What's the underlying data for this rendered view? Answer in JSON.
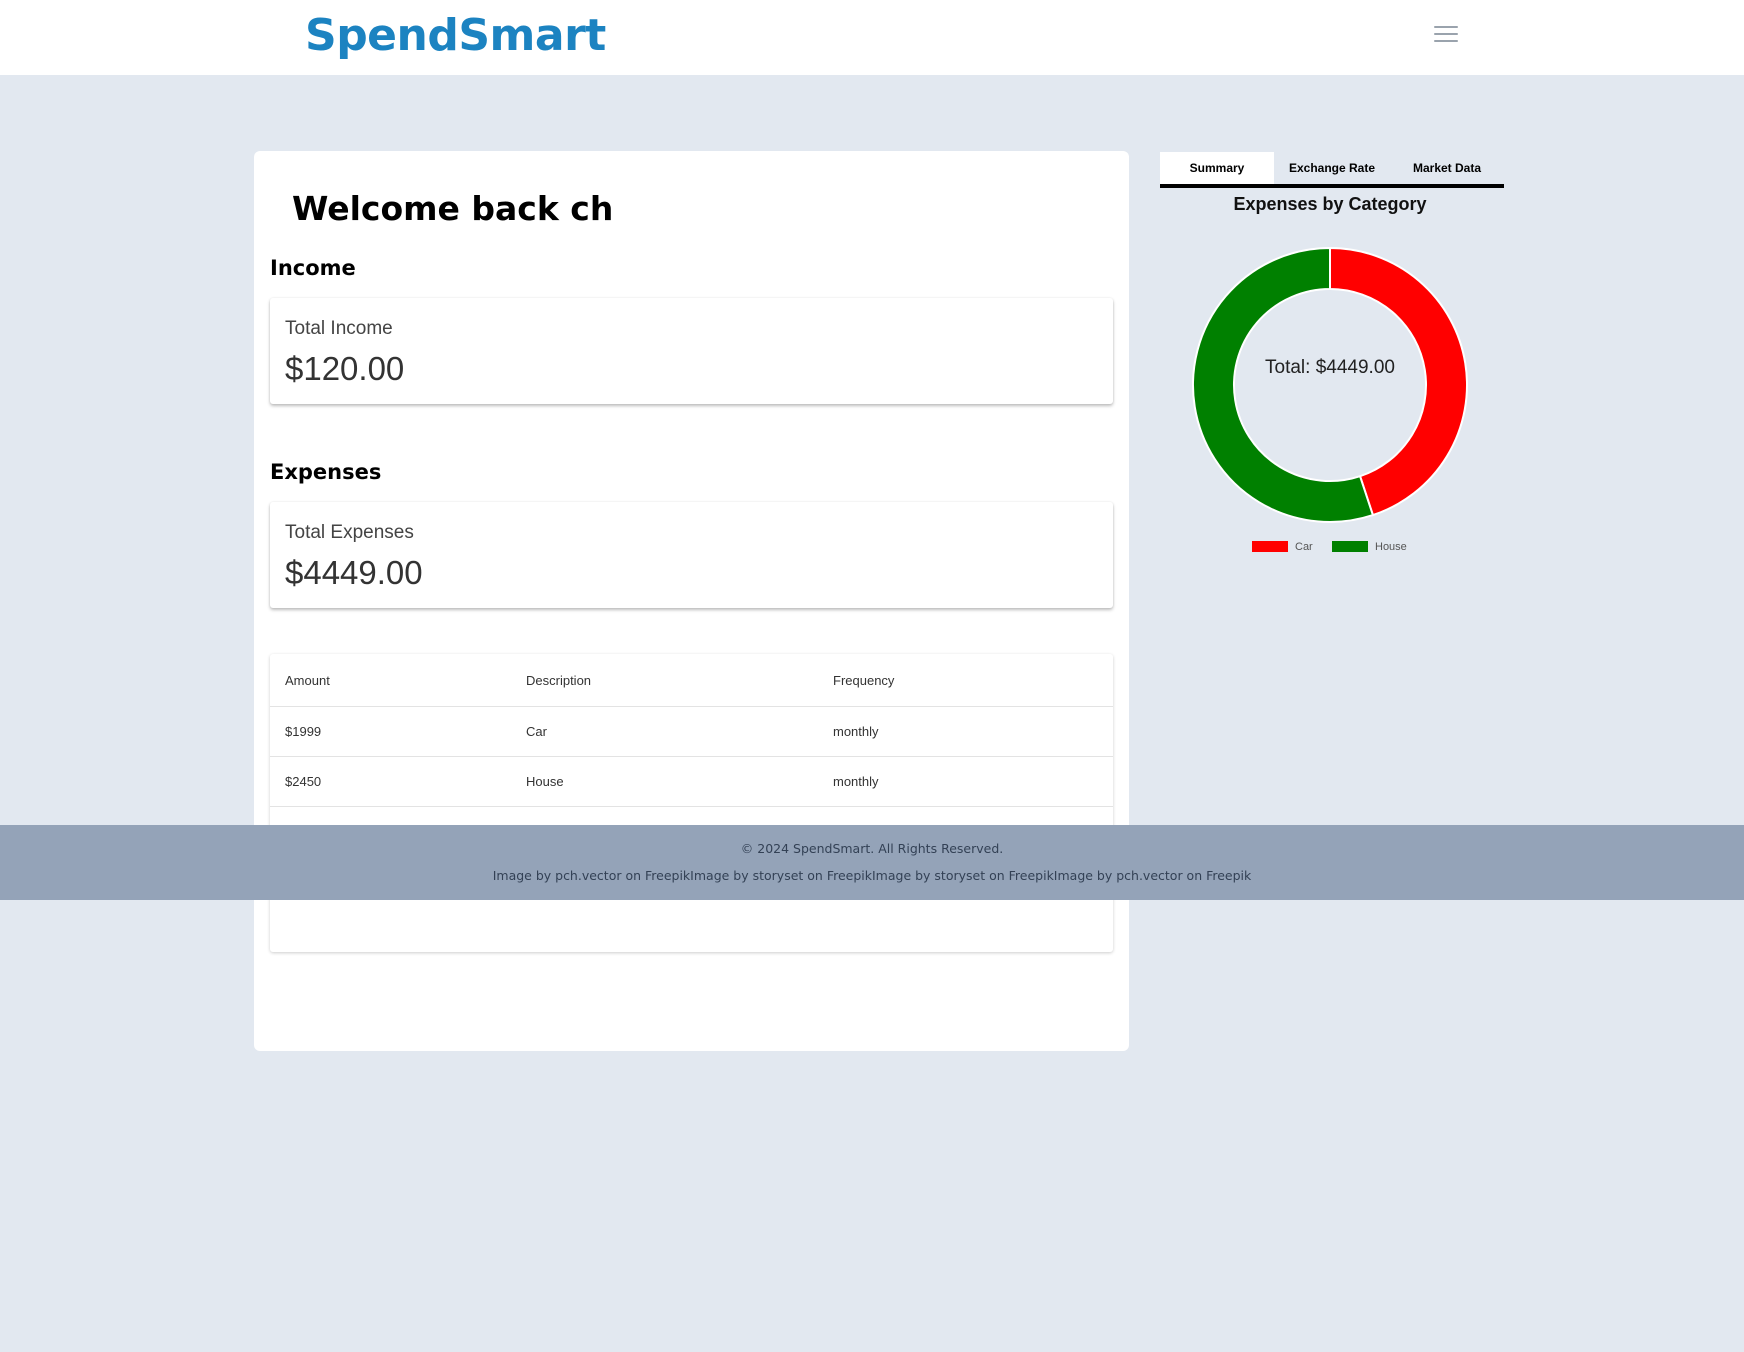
{
  "header": {
    "logo": "SpendSmart",
    "menu_icon": "hamburger-menu-icon"
  },
  "main": {
    "welcome": "Welcome back ch",
    "income": {
      "section_title": "Income",
      "label": "Total Income",
      "value": "$120.00"
    },
    "expenses": {
      "section_title": "Expenses",
      "label": "Total Expenses",
      "value": "$4449.00"
    },
    "table": {
      "headers": [
        "Amount",
        "Description",
        "Frequency"
      ],
      "rows": [
        [
          "$1999",
          "Car",
          "monthly"
        ],
        [
          "$2450",
          "House",
          "monthly"
        ]
      ]
    }
  },
  "side": {
    "tabs": [
      {
        "label": "Summary",
        "active": true
      },
      {
        "label": "Exchange Rate",
        "active": false
      },
      {
        "label": "Market Data",
        "active": false
      }
    ],
    "center_text": "Total: $4449.00"
  },
  "chart_data": {
    "type": "pie",
    "title": "Expenses by Category",
    "categories": [
      "Car",
      "House"
    ],
    "values": [
      1999,
      2450
    ],
    "colors": [
      "#ff0000",
      "#008000"
    ],
    "legend": "bottom"
  },
  "footer": {
    "copyright": "© 2024 SpendSmart. All Rights Reserved.",
    "credits": "Image by pch.vector on FreepikImage by storyset on FreepikImage by storyset on FreepikImage by pch.vector on Freepik"
  }
}
